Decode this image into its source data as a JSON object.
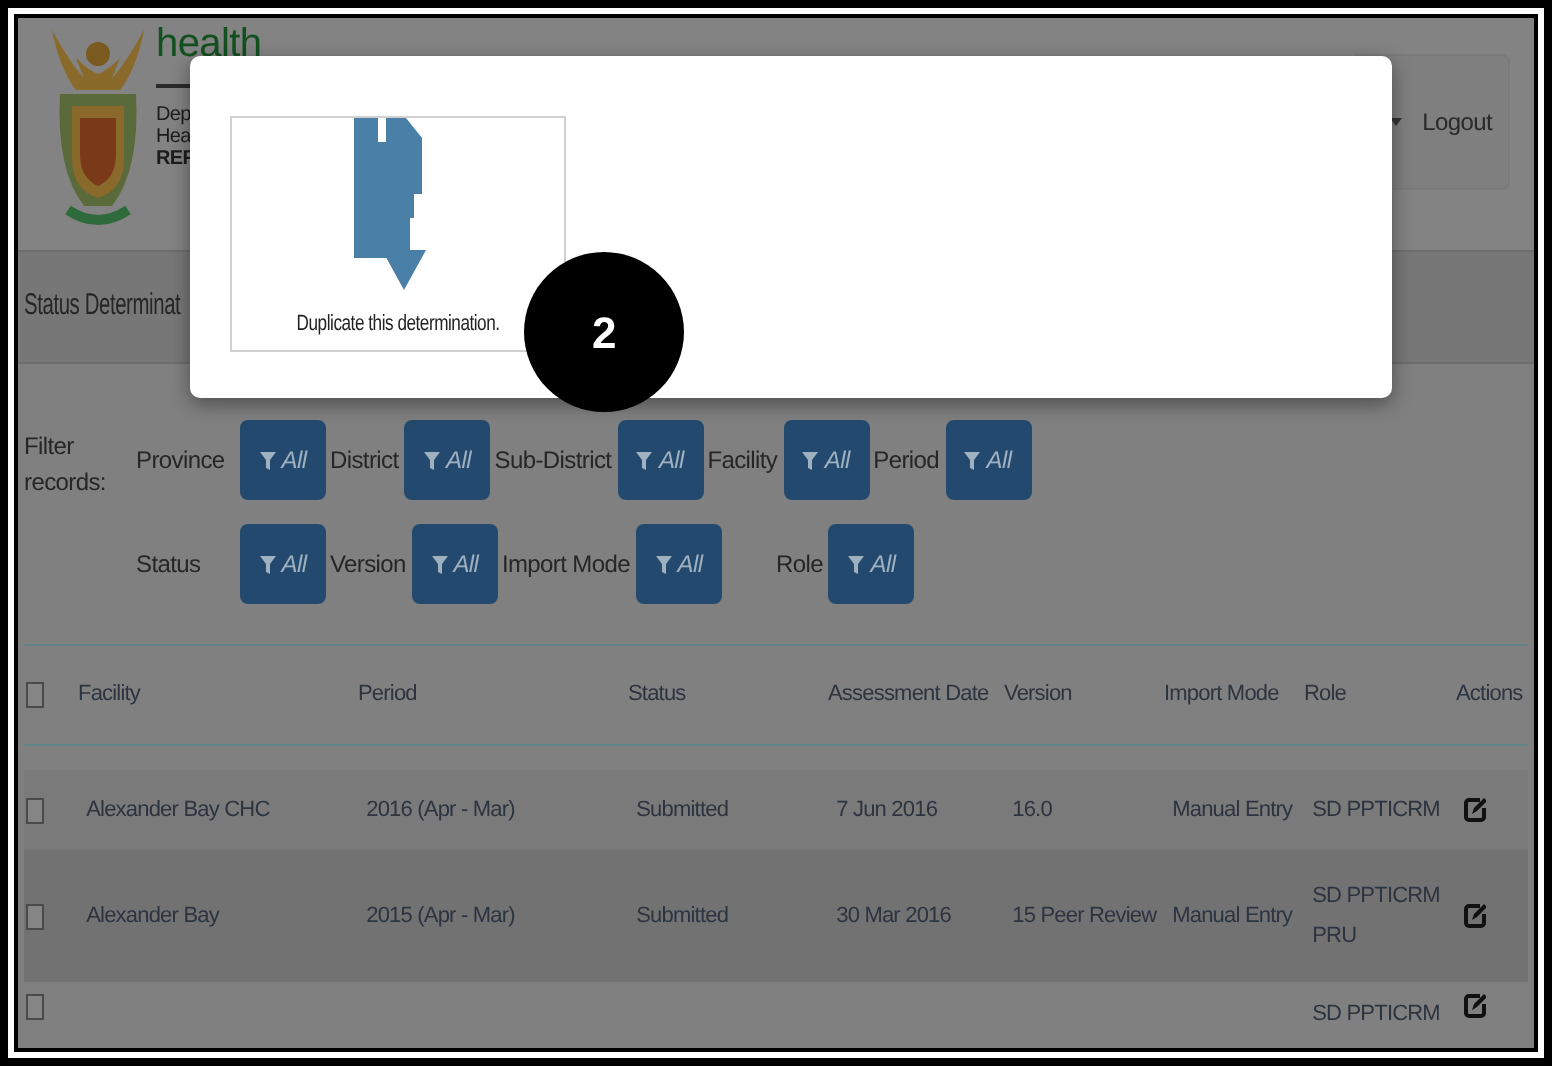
{
  "header": {
    "brand": "health",
    "lines": [
      "Dep",
      "Hea",
      "REF"
    ],
    "logout": "Logout"
  },
  "page_title": "Status Determinat",
  "modal": {
    "card_caption": "Duplicate this determination.",
    "step_badge": "2"
  },
  "filters": {
    "label": "Filter records:",
    "rows": [
      [
        {
          "label": "Province",
          "value": "All"
        },
        {
          "label": "District",
          "value": "All"
        },
        {
          "label": "Sub-District",
          "value": "All"
        },
        {
          "label": "Facility",
          "value": "All"
        },
        {
          "label": "Period",
          "value": "All"
        }
      ],
      [
        {
          "label": "Status",
          "value": "All"
        },
        {
          "label": "Version",
          "value": "All"
        },
        {
          "label": "Import Mode",
          "value": "All"
        },
        {
          "label": "Role",
          "value": "All"
        }
      ]
    ]
  },
  "table": {
    "select_all_checked": false,
    "columns": [
      "Facility",
      "Period",
      "Status",
      "Assessment Date",
      "Version",
      "Import Mode",
      "Role",
      "Actions"
    ],
    "rows": [
      {
        "checked": false,
        "cells": [
          "Alexander Bay CHC",
          "2016 (Apr - Mar)",
          "Submitted",
          "7 Jun 2016",
          "16.0",
          "Manual Entry",
          "SD PPTICRM"
        ]
      },
      {
        "checked": false,
        "cells": [
          "Alexander Bay",
          "2015 (Apr - Mar)",
          "Submitted",
          "30 Mar 2016",
          "15 Peer Review",
          "Manual Entry",
          "SD PPTICRM PRU"
        ]
      },
      {
        "checked": false,
        "cells": [
          null,
          null,
          null,
          null,
          null,
          null,
          "SD PPTICRM"
        ]
      }
    ]
  }
}
